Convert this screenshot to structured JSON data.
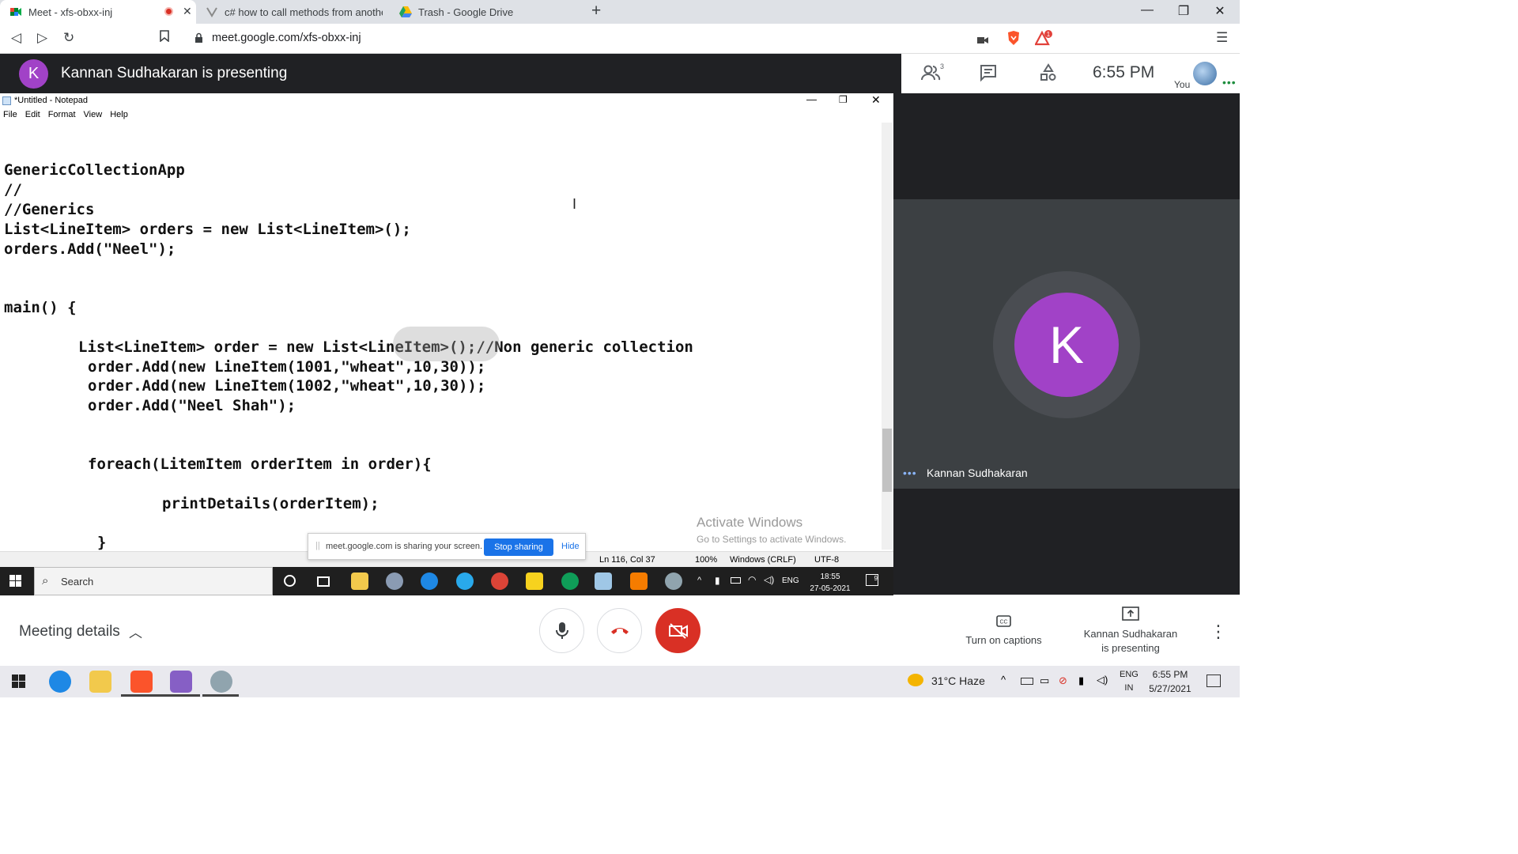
{
  "browser": {
    "tabs": [
      {
        "title": "Meet - xfs-obxx-inj",
        "active": true,
        "recording": true
      },
      {
        "title": "c# how to call methods from another",
        "active": false
      },
      {
        "title": "Trash - Google Drive",
        "active": false
      }
    ],
    "new_tab": "+",
    "url": "meet.google.com/xfs-obxx-inj",
    "alert_count": "1"
  },
  "meet": {
    "presenter_initial": "K",
    "presenting_text": "Kannan Sudhakaran is presenting",
    "people_count": "3",
    "clock": "6:55 PM",
    "you_label": "You",
    "tile_name": "Kannan Sudhakaran",
    "tile_initial": "K",
    "meeting_details": "Meeting details",
    "captions_label": "Turn on captions",
    "presenting_label_line1": "Kannan Sudhakaran",
    "presenting_label_line2": "is presenting",
    "colors": {
      "accent_purple": "#a142c7",
      "end_call_red": "#d93025",
      "dark_bg": "#202124"
    }
  },
  "notepad": {
    "title": "*Untitled - Notepad",
    "menu": [
      "File",
      "Edit",
      "Format",
      "View",
      "Help"
    ],
    "lines": [
      "GenericCollectionApp",
      "//",
      "//Generics",
      "List<LineItem> orders = new List<LineItem>();",
      "orders.Add(\"Neel\");",
      "main() {",
      "List<LineItem> order = new List<LineItem>();//Non generic collection",
      "order.Add(new LineItem(1001,\"wheat\",10,30));",
      "order.Add(new LineItem(1002,\"wheat\",10,30));",
      "order.Add(\"Neel Shah\");",
      "foreach(LitemItem orderItem in order){",
      "printDetails(orderItem);",
      "}"
    ],
    "status": {
      "position": "Ln 116, Col 37",
      "zoom": "100%",
      "line_endings": "Windows (CRLF)",
      "encoding": "UTF-8"
    }
  },
  "activate": {
    "line1": "Activate Windows",
    "line2": "Go to Settings to activate Windows."
  },
  "share_bar": {
    "message": "meet.google.com is sharing your screen.",
    "stop": "Stop sharing",
    "hide": "Hide"
  },
  "inner_taskbar": {
    "search": "Search",
    "lang": "ENG",
    "time": "18:55",
    "date": "27-05-2021",
    "notif": "9"
  },
  "outer_taskbar": {
    "weather": "31°C  Haze",
    "lang1": "ENG",
    "lang2": "IN",
    "time": "6:55 PM",
    "date": "5/27/2021"
  }
}
